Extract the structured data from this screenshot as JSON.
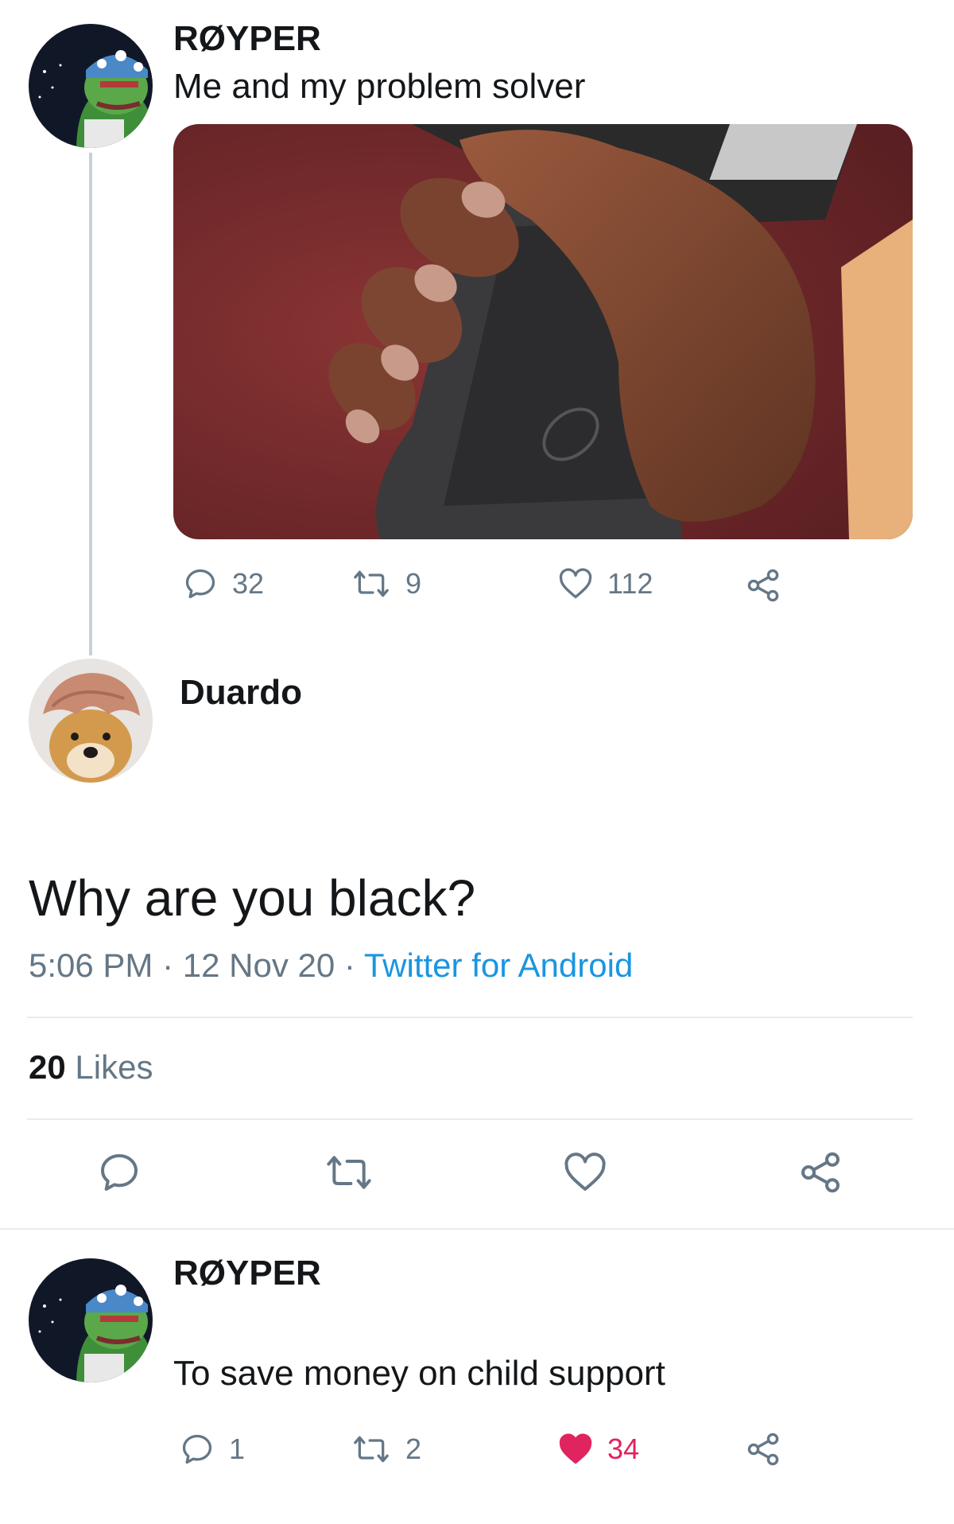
{
  "tweet1": {
    "author": "RØYPER",
    "text": "Me and my problem solver",
    "replies": "32",
    "retweets": "9",
    "likes": "112"
  },
  "tweet2": {
    "author": "Duardo",
    "text": "Why are you black?",
    "time": "5:06 PM",
    "date": "12 Nov 20",
    "separator": "·",
    "source": "Twitter for Android",
    "likes_count": "20",
    "likes_label": "Likes"
  },
  "tweet3": {
    "author": "RØYPER",
    "text": "To save money on child support",
    "replies": "1",
    "retweets": "2",
    "likes": "34"
  },
  "colors": {
    "muted": "#657786",
    "link": "#1b95e0",
    "liked": "#e0245e",
    "divider": "#e6ecf0"
  },
  "icons": [
    "reply-icon",
    "retweet-icon",
    "like-icon",
    "share-icon"
  ]
}
